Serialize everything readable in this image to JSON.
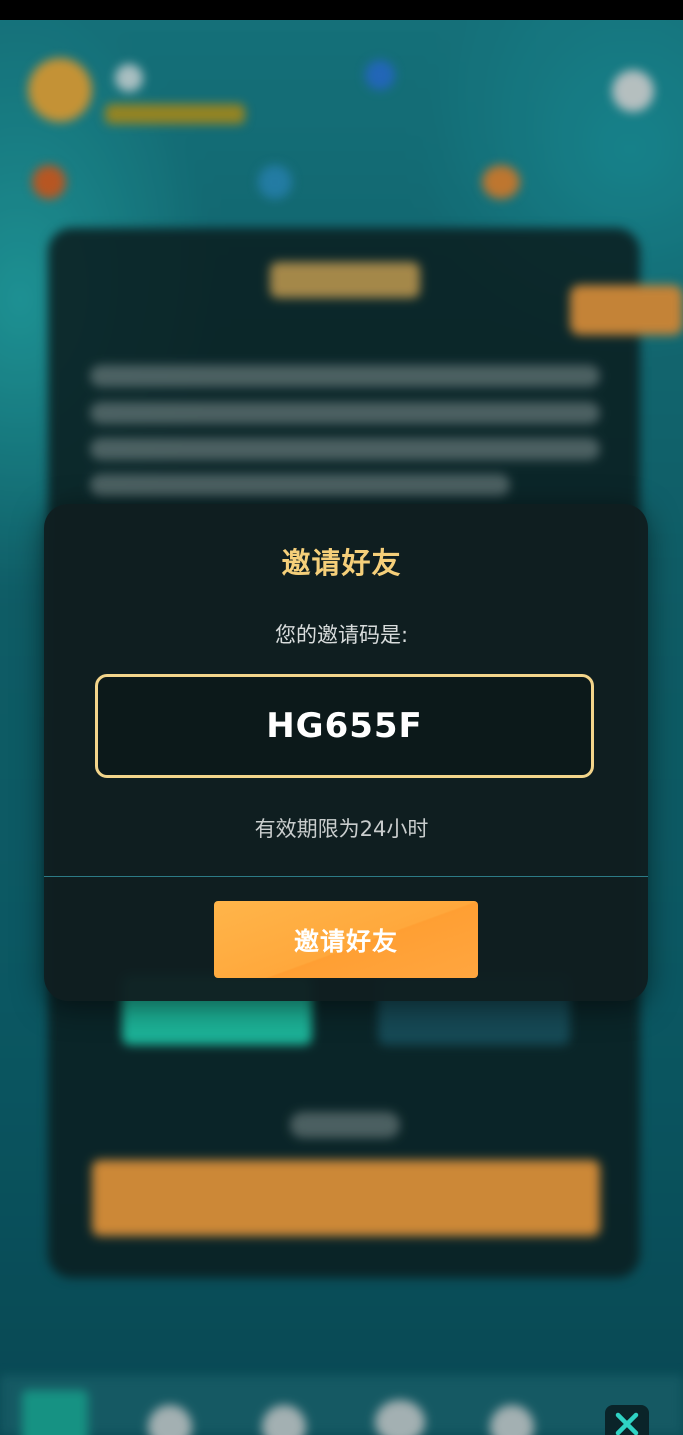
{
  "modal": {
    "title": "邀请好友",
    "prompt": "您的邀请码是:",
    "invite_code": "HG655F",
    "validity_note": "有效期限为24小时",
    "invite_button_label": "邀请好友"
  },
  "icons": {
    "close": "close-icon"
  },
  "colors": {
    "title": "#f5cf7a",
    "code_border": "#f3d58b",
    "button": "#ffa83c",
    "modal_bg": "#101e20",
    "divider": "#2c7b86"
  }
}
